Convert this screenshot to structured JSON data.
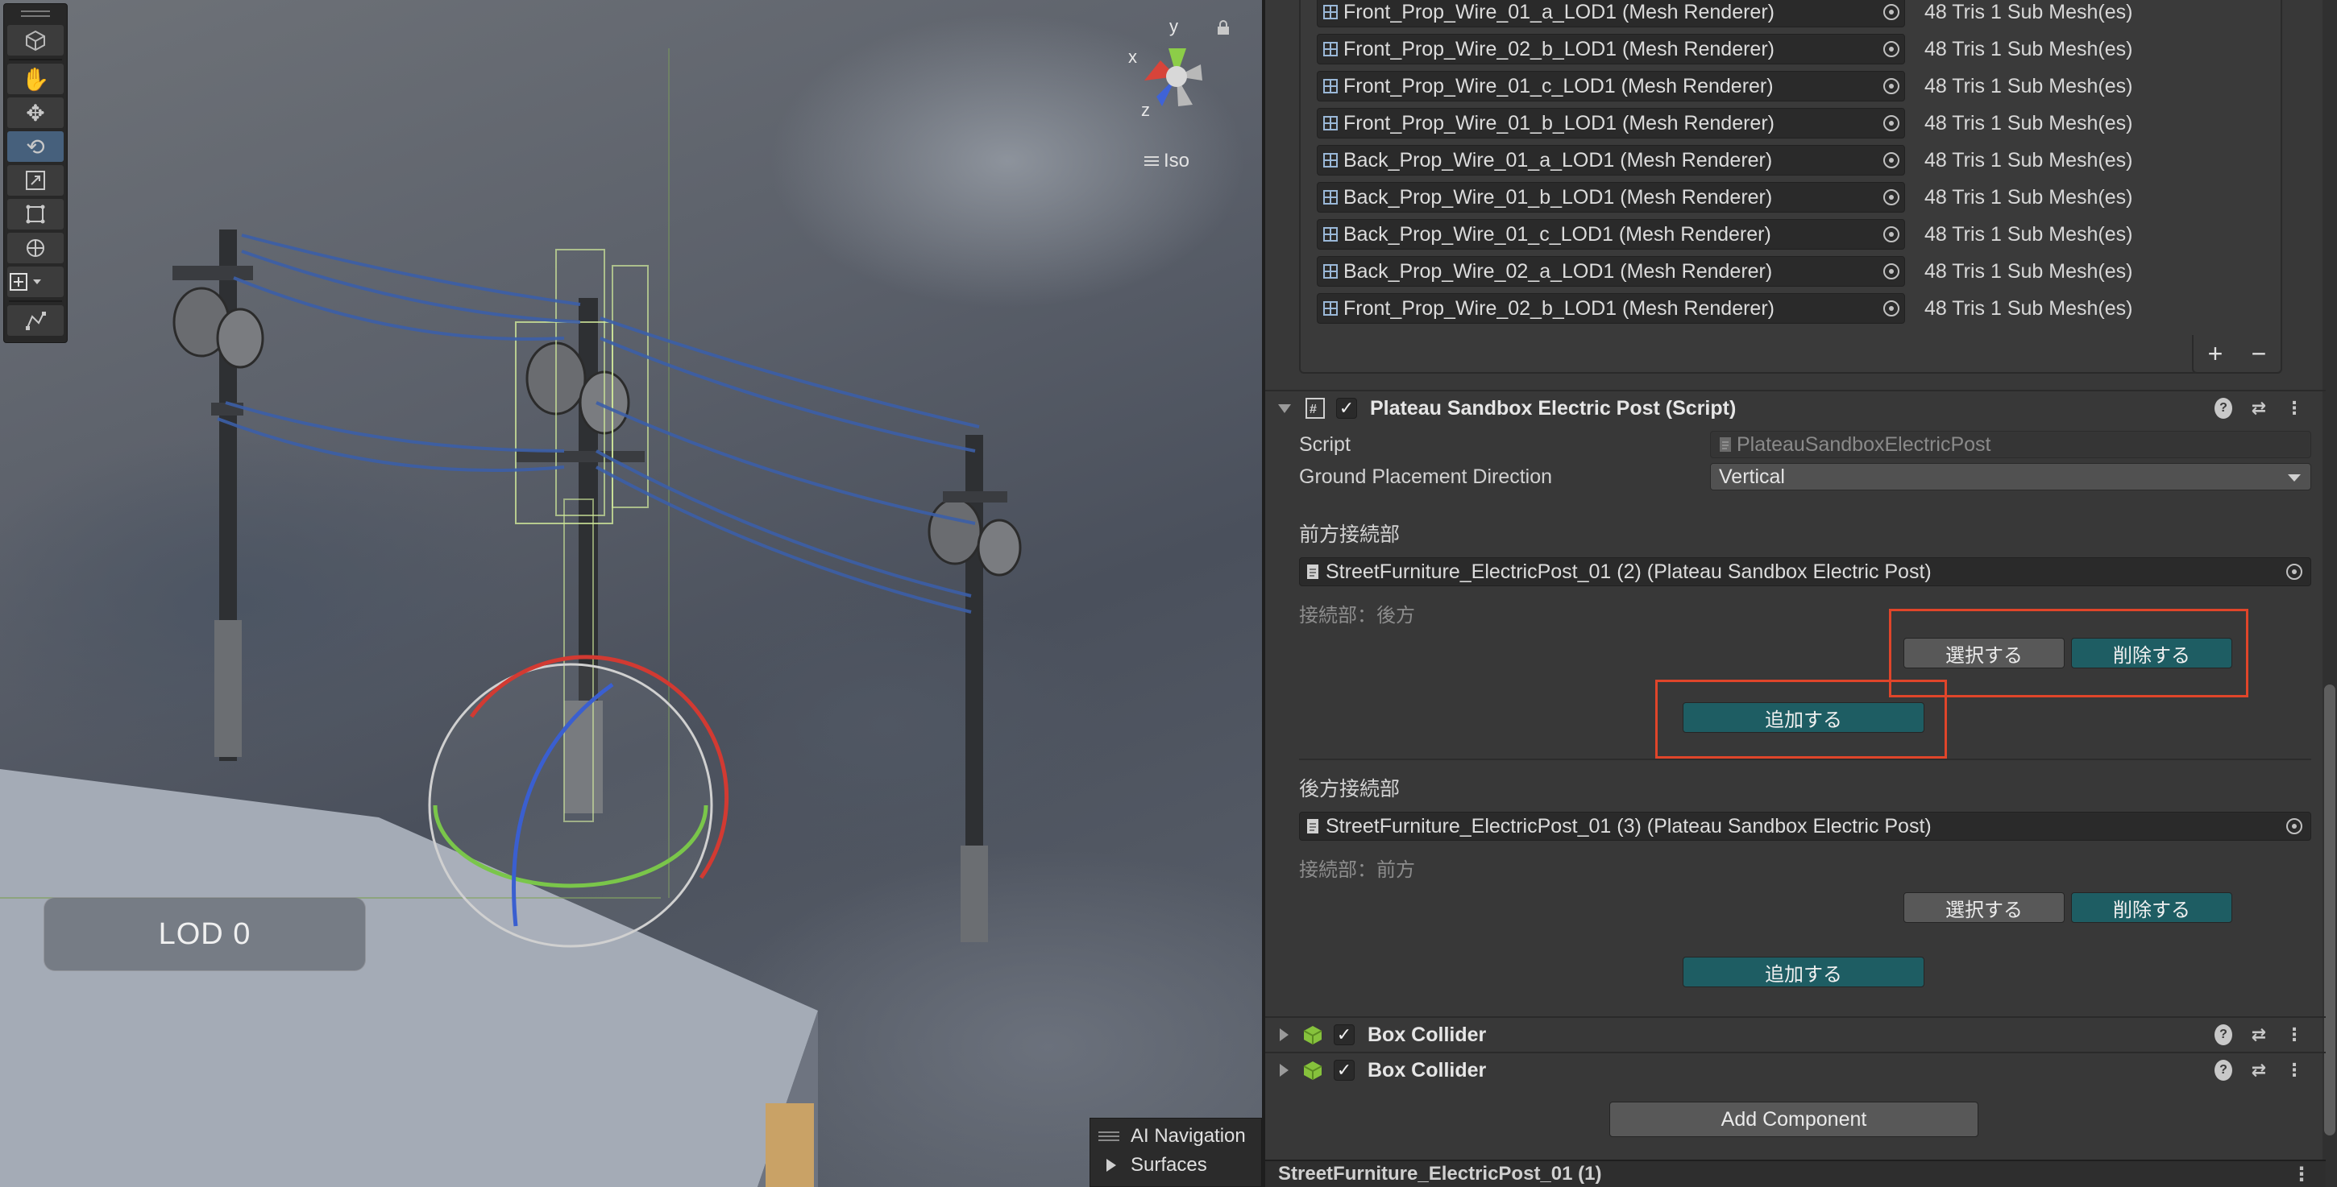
{
  "scene": {
    "gizmo": {
      "x_label": "x",
      "y_label": "y",
      "z_label": "z",
      "projection": "Iso"
    },
    "lod_badge": "LOD 0",
    "overlay": {
      "title": "AI Navigation",
      "item": "Surfaces"
    },
    "toolbar_tools": [
      "view-tool",
      "hand-tool",
      "move-tool",
      "rotate-tool",
      "scale-tool",
      "rect-tool",
      "transform-tool",
      "add-tool",
      "custom-tool"
    ]
  },
  "lod_list": {
    "rows": [
      {
        "name": "Front_Prop_Wire_01_a_LOD1 (Mesh Renderer)",
        "tris": "48 Tris",
        "submesh": "1 Sub Mesh(es)"
      },
      {
        "name": "Front_Prop_Wire_02_b_LOD1 (Mesh Renderer)",
        "tris": "48 Tris",
        "submesh": "1 Sub Mesh(es)"
      },
      {
        "name": "Front_Prop_Wire_01_c_LOD1 (Mesh Renderer)",
        "tris": "48 Tris",
        "submesh": "1 Sub Mesh(es)"
      },
      {
        "name": "Front_Prop_Wire_01_b_LOD1 (Mesh Renderer)",
        "tris": "48 Tris",
        "submesh": "1 Sub Mesh(es)"
      },
      {
        "name": "Back_Prop_Wire_01_a_LOD1 (Mesh Renderer)",
        "tris": "48 Tris",
        "submesh": "1 Sub Mesh(es)"
      },
      {
        "name": "Back_Prop_Wire_01_b_LOD1 (Mesh Renderer)",
        "tris": "48 Tris",
        "submesh": "1 Sub Mesh(es)"
      },
      {
        "name": "Back_Prop_Wire_01_c_LOD1 (Mesh Renderer)",
        "tris": "48 Tris",
        "submesh": "1 Sub Mesh(es)"
      },
      {
        "name": "Back_Prop_Wire_02_a_LOD1 (Mesh Renderer)",
        "tris": "48 Tris",
        "submesh": "1 Sub Mesh(es)"
      },
      {
        "name": "Front_Prop_Wire_02_b_LOD1 (Mesh Renderer)",
        "tris": "48 Tris",
        "submesh": "1 Sub Mesh(es)"
      }
    ],
    "add_label": "+",
    "remove_label": "−"
  },
  "electric_post": {
    "title": "Plateau Sandbox Electric Post (Script)",
    "script_label": "Script",
    "script_value": "PlateauSandboxElectricPost",
    "ground_label": "Ground Placement Direction",
    "ground_value": "Vertical",
    "front": {
      "heading": "前方接続部",
      "object": "StreetFurniture_ElectricPost_01 (2) (Plateau Sandbox Electric Post)",
      "connection": "接続部：後方",
      "select_label": "選択する",
      "delete_label": "削除する",
      "add_label": "追加する"
    },
    "back": {
      "heading": "後方接続部",
      "object": "StreetFurniture_ElectricPost_01 (3) (Plateau Sandbox Electric Post)",
      "connection": "接続部：前方",
      "select_label": "選択する",
      "delete_label": "削除する",
      "add_label": "追加する"
    }
  },
  "box_collider_1": "Box Collider",
  "box_collider_2": "Box Collider",
  "add_component": "Add Component",
  "footer_object": "StreetFurniture_ElectricPost_01 (1)",
  "colors": {
    "accent_teal": "#1e5d63",
    "highlight_red": "#e0452a",
    "selection_blue": "#46607c"
  }
}
